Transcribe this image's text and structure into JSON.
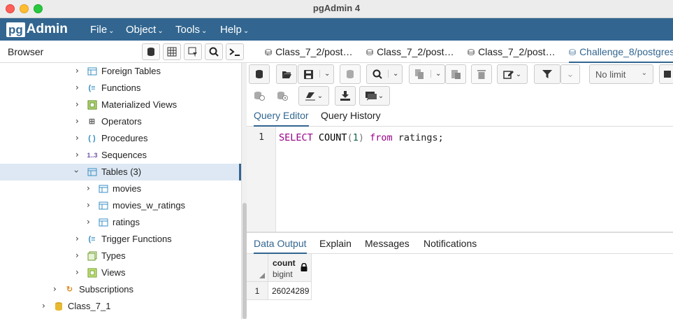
{
  "window": {
    "title": "pgAdmin 4"
  },
  "app": {
    "logo_pg": "pg",
    "logo_admin": "Admin"
  },
  "menu": [
    "File",
    "Object",
    "Tools",
    "Help"
  ],
  "browser": {
    "title": "Browser",
    "tree": [
      {
        "label": "Foreign Tables",
        "icon": "foreign-table-icon"
      },
      {
        "label": "Functions",
        "icon": "function-icon"
      },
      {
        "label": "Materialized Views",
        "icon": "materialized-view-icon"
      },
      {
        "label": "Operators",
        "icon": "operator-icon"
      },
      {
        "label": "Procedures",
        "icon": "procedure-icon"
      },
      {
        "label": "Sequences",
        "icon": "sequence-icon",
        "glyph": "1..3"
      },
      {
        "label": "Tables (3)",
        "icon": "table-icon",
        "selected": true,
        "expanded": true
      },
      {
        "label": "movies",
        "icon": "table-icon"
      },
      {
        "label": "movies_w_ratings",
        "icon": "table-icon"
      },
      {
        "label": "ratings",
        "icon": "table-icon"
      },
      {
        "label": "Trigger Functions",
        "icon": "trigger-function-icon"
      },
      {
        "label": "Types",
        "icon": "type-icon"
      },
      {
        "label": "Views",
        "icon": "view-icon"
      },
      {
        "label": "Subscriptions",
        "icon": "subscription-icon"
      },
      {
        "label": "Class_7_1",
        "icon": "database-icon"
      }
    ]
  },
  "tabs": [
    {
      "label": "."
    },
    {
      "label": "Class_7_2/post…"
    },
    {
      "label": "Class_7_2/post…"
    },
    {
      "label": "Class_7_2/post…"
    },
    {
      "label": "Challenge_8/postgres",
      "active": true
    }
  ],
  "toolbar": {
    "limit": "No limit"
  },
  "editor": {
    "tabs": [
      "Query Editor",
      "Query History"
    ],
    "line_number": "1",
    "query": {
      "kw1": "SELECT",
      "fn": "COUNT",
      "open": "(",
      "arg": "1",
      "close": ")",
      "kw2": "from",
      "rest": "ratings;"
    }
  },
  "output": {
    "tabs": [
      "Data Output",
      "Explain",
      "Messages",
      "Notifications"
    ],
    "column": {
      "name": "count",
      "type": "bigint"
    },
    "rows": [
      {
        "num": "1",
        "value": "26024289"
      }
    ]
  },
  "colors": {
    "brand": "#326690",
    "selected_row": "#dde8f4"
  }
}
